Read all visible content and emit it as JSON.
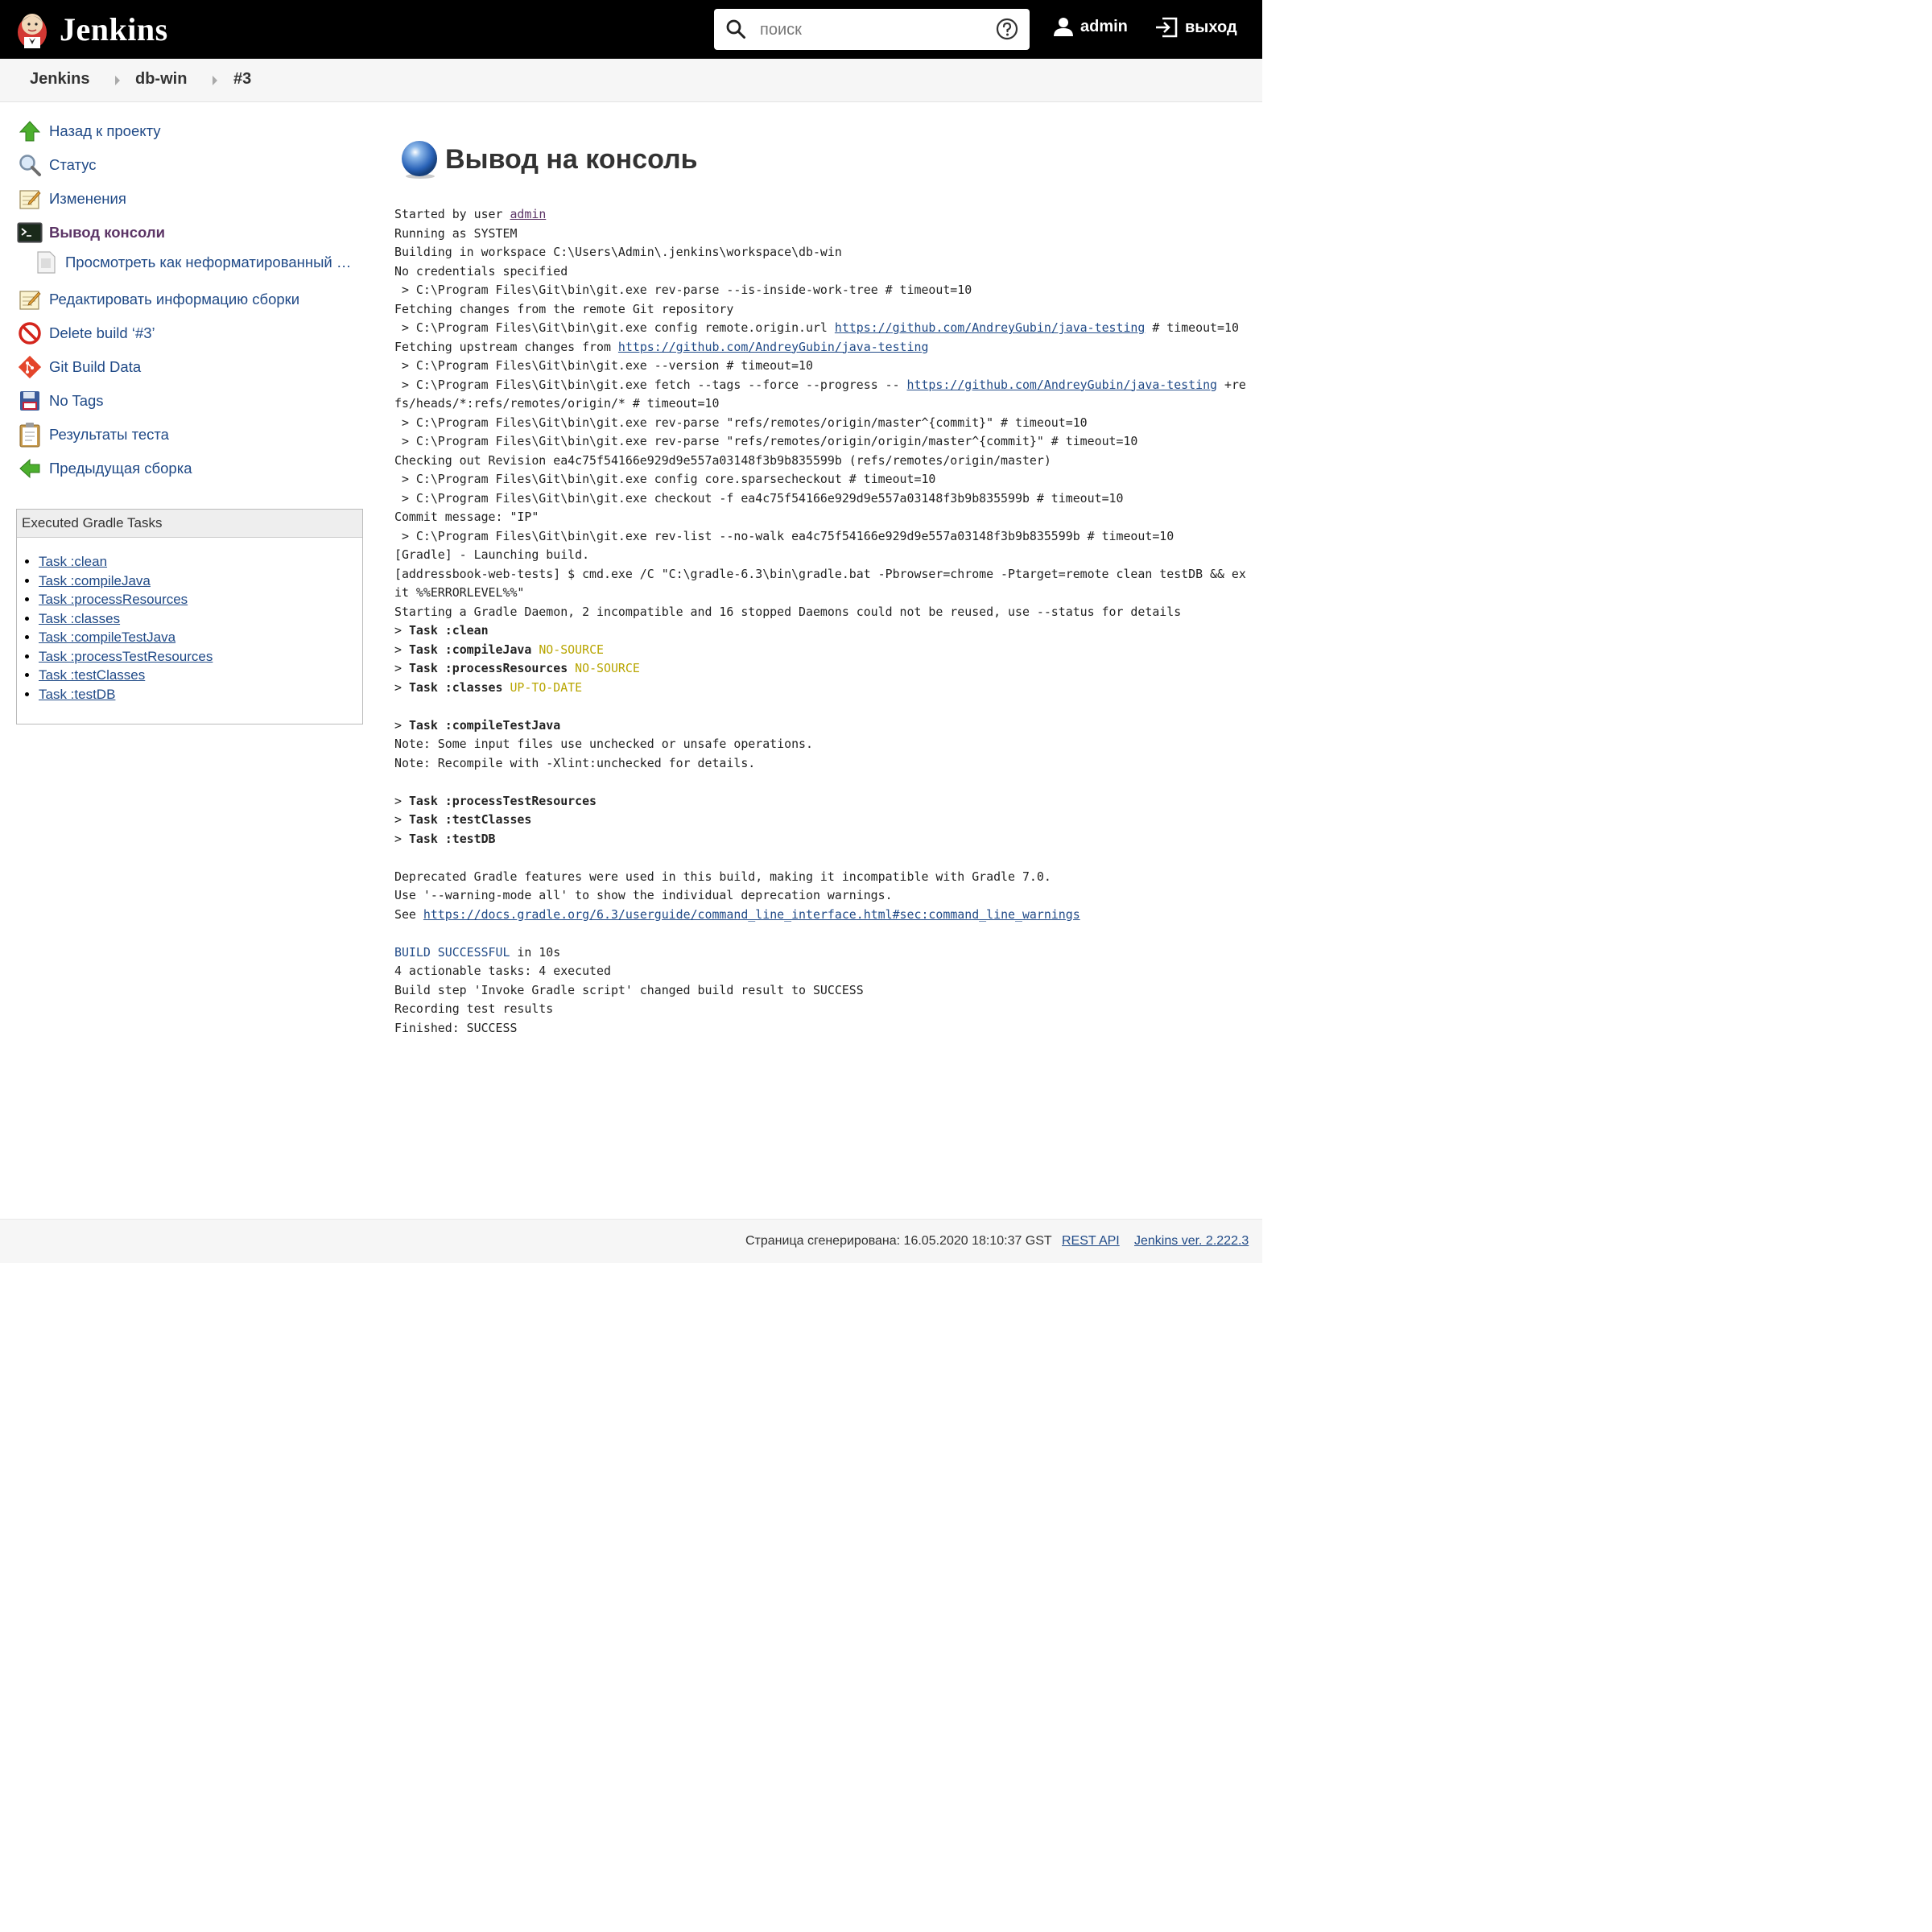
{
  "header": {
    "brand": "Jenkins",
    "search_placeholder": "поиск",
    "user": "admin",
    "logout": "выход"
  },
  "breadcrumb": [
    "Jenkins",
    "db-win",
    "#3"
  ],
  "sidebar": {
    "items": [
      {
        "label": "Назад к проекту",
        "icon": "up-arrow-icon"
      },
      {
        "label": "Статус",
        "icon": "magnifier-icon"
      },
      {
        "label": "Изменения",
        "icon": "notepad-icon"
      },
      {
        "label": "Вывод консоли",
        "icon": "terminal-icon",
        "active": true
      },
      {
        "label": "Просмотреть как неформатированный т…",
        "icon": "document-icon"
      },
      {
        "label": "Редактировать информацию сборки",
        "icon": "notepad-icon"
      },
      {
        "label": "Delete build ‘#3’",
        "icon": "no-entry-icon"
      },
      {
        "label": "Git Build Data",
        "icon": "git-icon"
      },
      {
        "label": "No Tags",
        "icon": "floppy-disk-icon"
      },
      {
        "label": "Результаты теста",
        "icon": "clipboard-icon"
      },
      {
        "label": "Предыдущая сборка",
        "icon": "left-arrow-icon"
      }
    ]
  },
  "gradle_tasks": {
    "title": "Executed Gradle Tasks",
    "items": [
      "Task :clean",
      "Task :compileJava",
      "Task :processResources",
      "Task :classes",
      "Task :compileTestJava",
      "Task :processTestResources",
      "Task :testClasses",
      "Task :testDB"
    ]
  },
  "main": {
    "title": "Вывод на консоль",
    "console": [
      [
        [
          "t",
          "Started by user "
        ],
        [
          "user",
          "admin"
        ]
      ],
      [
        [
          "t",
          "Running as SYSTEM"
        ]
      ],
      [
        [
          "t",
          "Building in workspace C:\\Users\\Admin\\.jenkins\\workspace\\db-win"
        ]
      ],
      [
        [
          "t",
          "No credentials specified"
        ]
      ],
      [
        [
          "t",
          " > C:\\Program Files\\Git\\bin\\git.exe rev-parse --is-inside-work-tree # timeout=10"
        ]
      ],
      [
        [
          "t",
          "Fetching changes from the remote Git repository"
        ]
      ],
      [
        [
          "t",
          " > C:\\Program Files\\Git\\bin\\git.exe config remote.origin.url "
        ],
        [
          "link",
          "https://github.com/AndreyGubin/java-testing"
        ],
        [
          "t",
          " # timeout=10"
        ]
      ],
      [
        [
          "t",
          "Fetching upstream changes from "
        ],
        [
          "link",
          "https://github.com/AndreyGubin/java-testing"
        ]
      ],
      [
        [
          "t",
          " > C:\\Program Files\\Git\\bin\\git.exe --version # timeout=10"
        ]
      ],
      [
        [
          "t",
          " > C:\\Program Files\\Git\\bin\\git.exe fetch --tags --force --progress -- "
        ],
        [
          "link",
          "https://github.com/AndreyGubin/java-testing"
        ],
        [
          "t",
          " +refs/heads/*:refs/remotes/origin/* # timeout=10"
        ]
      ],
      [
        [
          "t",
          " > C:\\Program Files\\Git\\bin\\git.exe rev-parse \"refs/remotes/origin/master^{commit}\" # timeout=10"
        ]
      ],
      [
        [
          "t",
          " > C:\\Program Files\\Git\\bin\\git.exe rev-parse \"refs/remotes/origin/origin/master^{commit}\" # timeout=10"
        ]
      ],
      [
        [
          "t",
          "Checking out Revision ea4c75f54166e929d9e557a03148f3b9b835599b (refs/remotes/origin/master)"
        ]
      ],
      [
        [
          "t",
          " > C:\\Program Files\\Git\\bin\\git.exe config core.sparsecheckout # timeout=10"
        ]
      ],
      [
        [
          "t",
          " > C:\\Program Files\\Git\\bin\\git.exe checkout -f ea4c75f54166e929d9e557a03148f3b9b835599b # timeout=10"
        ]
      ],
      [
        [
          "t",
          "Commit message: \"IP\""
        ]
      ],
      [
        [
          "t",
          " > C:\\Program Files\\Git\\bin\\git.exe rev-list --no-walk ea4c75f54166e929d9e557a03148f3b9b835599b # timeout=10"
        ]
      ],
      [
        [
          "t",
          "[Gradle] - Launching build."
        ]
      ],
      [
        [
          "t",
          "[addressbook-web-tests] $ cmd.exe /C \"C:\\gradle-6.3\\bin\\gradle.bat -Pbrowser=chrome -Ptarget=remote clean testDB && exit %%ERRORLEVEL%%\""
        ]
      ],
      [
        [
          "t",
          "Starting a Gradle Daemon, 2 incompatible and 16 stopped Daemons could not be reused, use --status for details"
        ]
      ],
      [
        [
          "t",
          "> "
        ],
        [
          "b",
          "Task :clean"
        ]
      ],
      [
        [
          "t",
          "> "
        ],
        [
          "b",
          "Task :compileJava"
        ],
        [
          "t",
          " "
        ],
        [
          "y",
          "NO-SOURCE"
        ]
      ],
      [
        [
          "t",
          "> "
        ],
        [
          "b",
          "Task :processResources"
        ],
        [
          "t",
          " "
        ],
        [
          "y",
          "NO-SOURCE"
        ]
      ],
      [
        [
          "t",
          "> "
        ],
        [
          "b",
          "Task :classes"
        ],
        [
          "t",
          " "
        ],
        [
          "y",
          "UP-TO-DATE"
        ]
      ],
      [
        [
          "t",
          ""
        ]
      ],
      [
        [
          "t",
          "> "
        ],
        [
          "b",
          "Task :compileTestJava"
        ]
      ],
      [
        [
          "t",
          "Note: Some input files use unchecked or unsafe operations."
        ]
      ],
      [
        [
          "t",
          "Note: Recompile with -Xlint:unchecked for details."
        ]
      ],
      [
        [
          "t",
          ""
        ]
      ],
      [
        [
          "t",
          "> "
        ],
        [
          "b",
          "Task :processTestResources"
        ]
      ],
      [
        [
          "t",
          "> "
        ],
        [
          "b",
          "Task :testClasses"
        ]
      ],
      [
        [
          "t",
          "> "
        ],
        [
          "b",
          "Task :testDB"
        ]
      ],
      [
        [
          "t",
          ""
        ]
      ],
      [
        [
          "t",
          "Deprecated Gradle features were used in this build, making it incompatible with Gradle 7.0."
        ]
      ],
      [
        [
          "t",
          "Use '--warning-mode all' to show the individual deprecation warnings."
        ]
      ],
      [
        [
          "t",
          "See "
        ],
        [
          "link",
          "https://docs.gradle.org/6.3/userguide/command_line_interface.html#sec:command_line_warnings"
        ]
      ],
      [
        [
          "t",
          ""
        ]
      ],
      [
        [
          "bl",
          "BUILD SUCCESSFUL"
        ],
        [
          "t",
          " in 10s"
        ]
      ],
      [
        [
          "t",
          "4 actionable tasks: 4 executed"
        ]
      ],
      [
        [
          "t",
          "Build step 'Invoke Gradle script' changed build result to SUCCESS"
        ]
      ],
      [
        [
          "t",
          "Recording test results"
        ]
      ],
      [
        [
          "t",
          "Finished: SUCCESS"
        ]
      ]
    ]
  },
  "footer": {
    "generated": "Страница сгенерирована: 16.05.2020 18:10:37 GST",
    "rest_api": "REST API",
    "version": "Jenkins ver. 2.222.3"
  },
  "colors": {
    "header_bg": "#000000",
    "link": "#204a87",
    "active": "#5c3566",
    "status_yellow": "#b8a500"
  }
}
